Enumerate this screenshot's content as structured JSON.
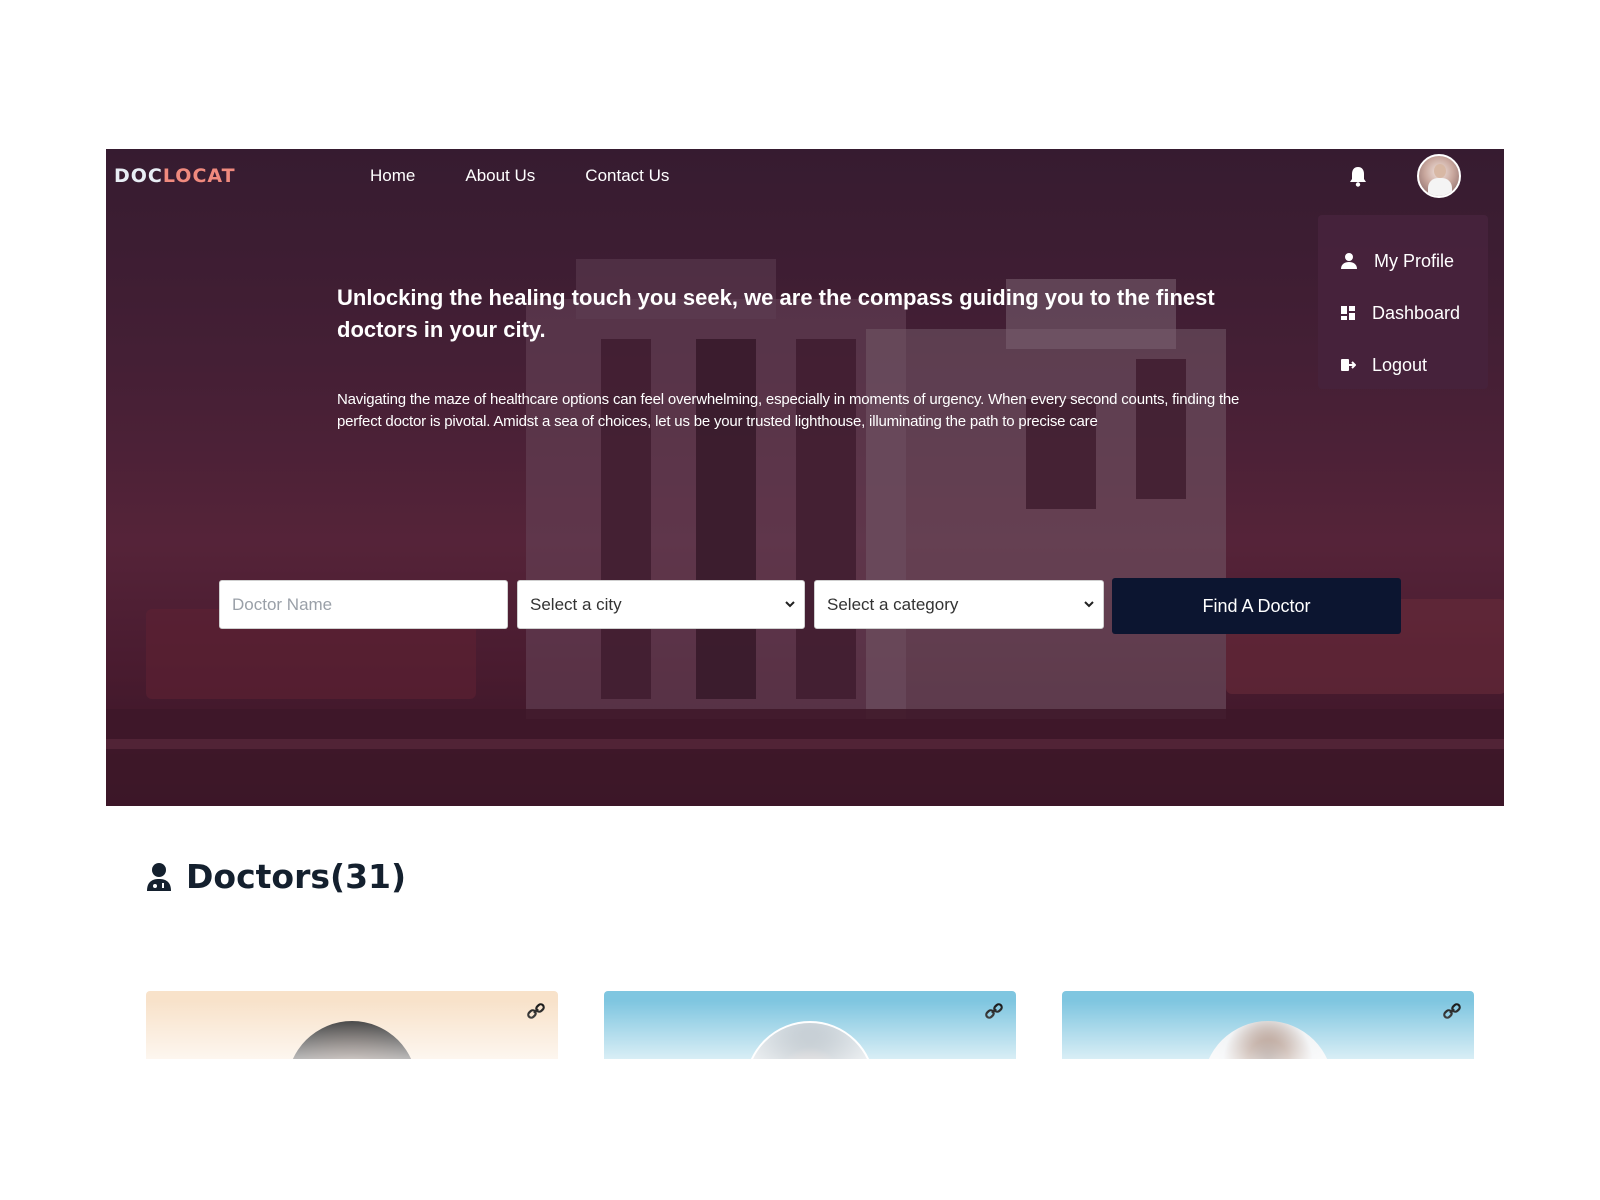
{
  "app": {
    "logo_part1": "DOC",
    "logo_part2": "LOCAT"
  },
  "nav": {
    "links": [
      "Home",
      "About Us",
      "Contact Us"
    ]
  },
  "header_icons": {
    "notification": "bell-icon",
    "avatar": "user-avatar"
  },
  "profile_menu": {
    "items": [
      {
        "label": "My Profile",
        "icon": "user-icon"
      },
      {
        "label": "Dashboard",
        "icon": "dashboard-icon"
      },
      {
        "label": "Logout",
        "icon": "logout-icon"
      }
    ]
  },
  "hero": {
    "headline": "Unlocking the healing touch you seek, we are the compass guiding you to the finest doctors in your city.",
    "subtext": "Navigating the maze of healthcare options can feel overwhelming, especially in moments of urgency. When every second counts, finding the perfect doctor is pivotal. Amidst a sea of choices, let us be your trusted lighthouse, illuminating the path to precise care"
  },
  "search": {
    "doctor_name_placeholder": "Doctor Name",
    "city_selected": "Select a city",
    "category_selected": "Select a category",
    "button_label": "Find A Doctor"
  },
  "doctors": {
    "title": "Doctors(31)",
    "cards": [
      {
        "bg_color": "#f8e2ca"
      },
      {
        "bg_color": "#7fc6e0"
      },
      {
        "bg_color": "#7fc6e0"
      }
    ]
  },
  "colors": {
    "accent_logo": "#f08a7e",
    "button_dark": "#0c1530",
    "hero_base": "#562940"
  }
}
